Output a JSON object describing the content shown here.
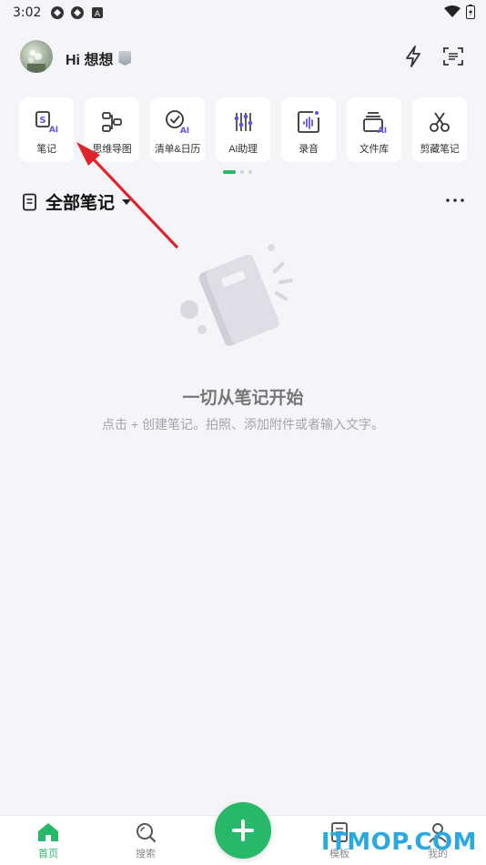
{
  "status_bar": {
    "time": "3:02"
  },
  "header": {
    "greeting": "Hi 想想"
  },
  "tools": [
    {
      "label": "笔记",
      "icon": "note-ai-icon"
    },
    {
      "label": "思维导图",
      "icon": "mindmap-icon"
    },
    {
      "label": "清单&日历",
      "icon": "checklist-ai-icon"
    },
    {
      "label": "AI助理",
      "icon": "ai-assistant-icon"
    },
    {
      "label": "录音",
      "icon": "voice-record-icon"
    },
    {
      "label": "文件库",
      "icon": "file-library-icon"
    },
    {
      "label": "剪藏笔记",
      "icon": "clip-icon"
    }
  ],
  "notes_header": {
    "title": "全部笔记"
  },
  "empty_state": {
    "title": "一切从笔记开始",
    "subtitle": "点击 + 创建笔记。拍照、添加附件或者输入文字。"
  },
  "bottom_nav": [
    {
      "label": "首页",
      "icon": "home-icon",
      "active": true
    },
    {
      "label": "搜索",
      "icon": "search-icon",
      "active": false
    },
    {
      "label": "模板",
      "icon": "template-icon",
      "active": false
    },
    {
      "label": "我的",
      "icon": "profile-icon",
      "active": false
    }
  ],
  "watermark": "ITMOP.COM",
  "colors": {
    "accent": "#27b86a",
    "ai_purple": "#6b4ce6",
    "annotation_red": "#e0242c"
  }
}
